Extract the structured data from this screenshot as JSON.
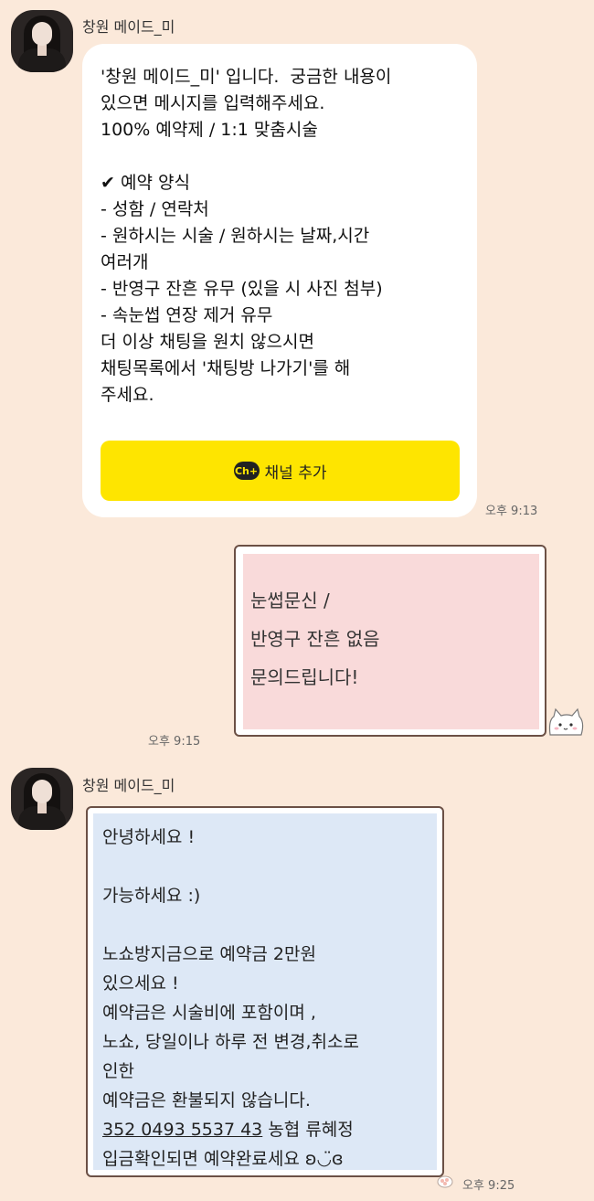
{
  "messages": [
    {
      "sender": "창원 메이드_미",
      "text": "'창원 메이드_미' 입니다.  궁금한 내용이\n있으면 메시지를 입력해주세요.\n100% 예약제 / 1:1 맞춤시술\n\n✔ 예약 양식\n- 성함 / 연락처\n- 원하시는 시술 / 원하시는 날짜,시간\n여러개\n- 반영구 잔흔 유무 (있을 시 사진 첨부)\n- 속눈썹 연장 제거 유무\n더 이상 채팅을 원치 않으시면\n채팅목록에서 '채팅방 나가기'를 해\n주세요.",
      "button_label": "채널 추가",
      "button_icon": "Ch+",
      "time": "오후 9:13"
    },
    {
      "text": "눈썹문신 /\n반영구 잔흔 없음\n문의드립니다!",
      "time": "오후 9:15"
    },
    {
      "sender": "창원 메이드_미",
      "text_before": "안녕하세요 !\n\n가능하세요 :)\n\n노쇼방지금으로 예약금 2만원\n있으세요 !\n예약금은 시술비에 포함이며 ,\n노쇼, 당일이나 하루 전 변경,취소로\n인한\n예약금은 환불되지 않습니다.",
      "bank": "352 0493 5537 43",
      "bank_after": " 농협 류혜정",
      "text_after": "입금확인되면 예약완료세요 ʚ◡̈ɞ",
      "time": "오후 9:25"
    }
  ]
}
